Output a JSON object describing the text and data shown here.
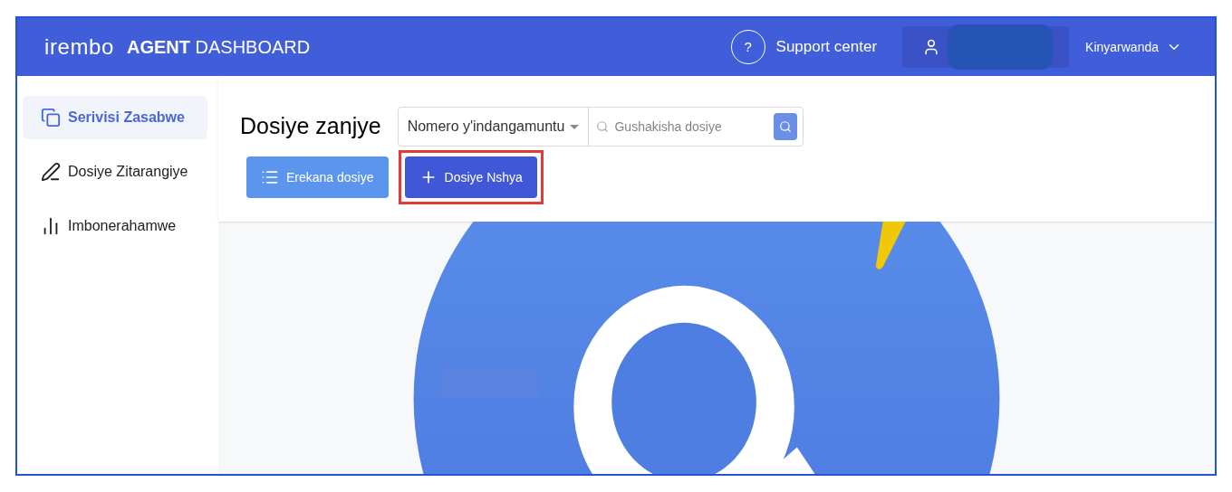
{
  "header": {
    "logo": "irembo",
    "title_bold": "AGENT",
    "title_rest": "DASHBOARD",
    "support": {
      "icon_text": "?",
      "label": "Support center"
    },
    "language": "Kinyarwanda"
  },
  "sidebar": {
    "items": [
      {
        "label": "Serivisi Zasabwe",
        "selected": true
      },
      {
        "label": "Dosiye Zitarangiye",
        "selected": false
      },
      {
        "label": "Imbonerahamwe",
        "selected": false
      }
    ]
  },
  "main": {
    "title": "Dosiye zanjye",
    "search_type": "Nomero y'indangamuntu",
    "search": {
      "placeholder": "Gushakisha dosiye"
    },
    "buttons": [
      {
        "label": "Erekana dosiye",
        "kind": "list",
        "highlighted": false
      },
      {
        "label": "Dosiye Nshya",
        "kind": "add",
        "highlighted": true
      }
    ]
  }
}
